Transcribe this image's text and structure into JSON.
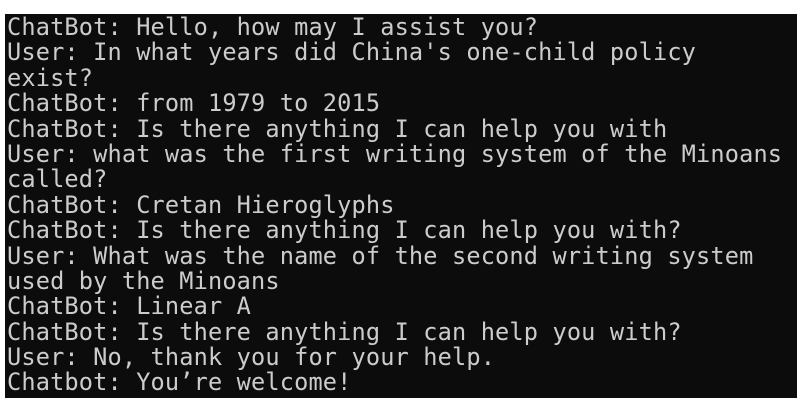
{
  "terminal": {
    "lines": [
      "ChatBot: Hello, how may I assist you?",
      "User: In what years did China's one-child policy",
      "exist?",
      "ChatBot: from 1979 to 2015",
      "ChatBot: Is there anything I can help you with",
      "User: what was the first writing system of the Minoans",
      "called?",
      "ChatBot: Cretan Hieroglyphs",
      "ChatBot: Is there anything I can help you with?",
      "User: What was the name of the second writing system",
      "used by the Minoans",
      "ChatBot: Linear A",
      "ChatBot: Is there anything I can help you with?",
      "User: No, thank you for your help.",
      "Chatbot: You’re welcome!"
    ],
    "colors": {
      "background": "#0c0c0c",
      "text": "#cccccc"
    }
  }
}
